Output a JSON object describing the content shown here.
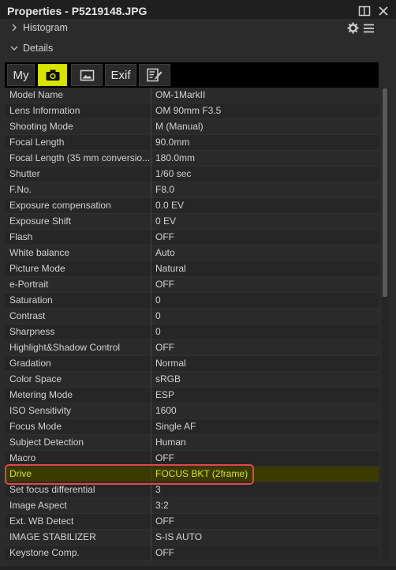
{
  "window": {
    "title": "Properties - P5219148.JPG"
  },
  "sections": {
    "histogram": "Histogram",
    "details": "Details"
  },
  "tabs": [
    {
      "label": "My",
      "icon": "my-text"
    },
    {
      "label": "",
      "icon": "camera-icon"
    },
    {
      "label": "",
      "icon": "image-icon"
    },
    {
      "label": "Exif",
      "icon": "exif-text"
    },
    {
      "label": "",
      "icon": "edit-notes-icon"
    }
  ],
  "active_tab": 1,
  "rows": [
    {
      "label": "Model Name",
      "value": "OM-1MarkII"
    },
    {
      "label": "Lens Information",
      "value": "OM 90mm F3.5"
    },
    {
      "label": "Shooting Mode",
      "value": "M (Manual)"
    },
    {
      "label": "Focal Length",
      "value": "90.0mm"
    },
    {
      "label": "Focal Length (35 mm conversio...",
      "value": "180.0mm"
    },
    {
      "label": "Shutter",
      "value": "1/60 sec"
    },
    {
      "label": "F.No.",
      "value": "F8.0"
    },
    {
      "label": "Exposure compensation",
      "value": "0.0 EV"
    },
    {
      "label": "Exposure Shift",
      "value": "0 EV"
    },
    {
      "label": "Flash",
      "value": "OFF"
    },
    {
      "label": "White balance",
      "value": "Auto"
    },
    {
      "label": "Picture Mode",
      "value": "Natural"
    },
    {
      "label": "e-Portrait",
      "value": "OFF"
    },
    {
      "label": "Saturation",
      "value": "0"
    },
    {
      "label": "Contrast",
      "value": "0"
    },
    {
      "label": "Sharpness",
      "value": "0"
    },
    {
      "label": "Highlight&Shadow Control",
      "value": "OFF"
    },
    {
      "label": "Gradation",
      "value": "Normal"
    },
    {
      "label": "Color Space",
      "value": "sRGB"
    },
    {
      "label": "Metering Mode",
      "value": "ESP"
    },
    {
      "label": "ISO Sensitivity",
      "value": "1600"
    },
    {
      "label": "Focus Mode",
      "value": "Single AF"
    },
    {
      "label": "Subject Detection",
      "value": "Human"
    },
    {
      "label": "Macro",
      "value": "OFF"
    },
    {
      "label": "Drive",
      "value": "FOCUS BKT (2frame)"
    },
    {
      "label": "Set focus differential",
      "value": "3"
    },
    {
      "label": "Image Aspect",
      "value": "3:2"
    },
    {
      "label": "Ext. WB Detect",
      "value": "OFF"
    },
    {
      "label": "IMAGE STABILIZER",
      "value": "S-IS AUTO"
    },
    {
      "label": "Keystone Comp.",
      "value": "OFF"
    }
  ],
  "highlighted_row": 24,
  "colors": {
    "active_tab": "#d8e400",
    "highlight_text": "#d7df2a",
    "annotation_box": "#e04848"
  }
}
